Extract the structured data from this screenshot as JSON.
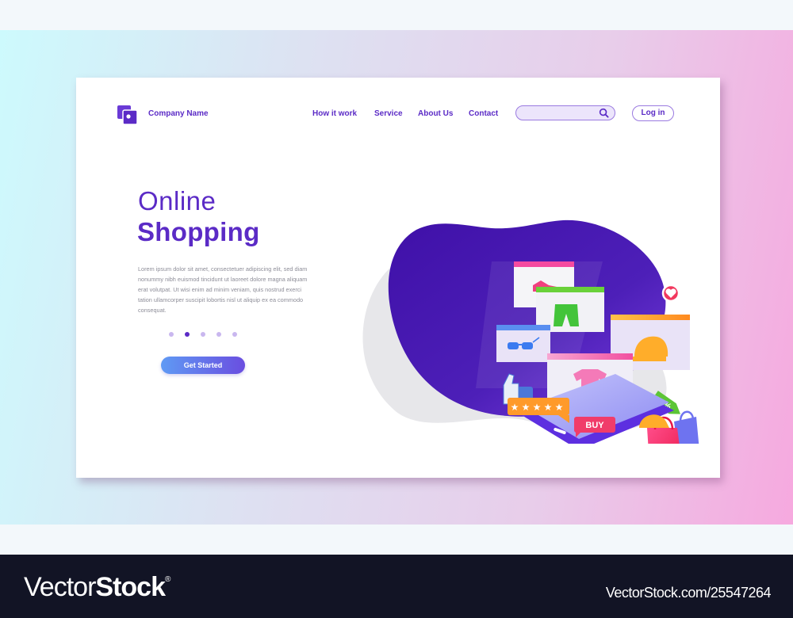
{
  "header": {
    "brand_name": "Company Name",
    "nav": [
      {
        "label": "How it work"
      },
      {
        "label": "Service"
      },
      {
        "label": "About Us"
      },
      {
        "label": "Contact"
      }
    ],
    "search": {
      "value": "",
      "placeholder": ""
    },
    "login_label": "Log in"
  },
  "hero": {
    "title_light": "Online",
    "title_bold": "Shopping",
    "description": "Lorem ipsum dolor sit amet, consectetuer adipiscing elit, sed diam nonummy nibh euismod tincidunt ut laoreet dolore magna aliquam erat volutpat. Ut wisi enim ad minim veniam, quis nostrud exerci tation ullamcorper suscipit lobortis nisl ut aliquip ex ea commodo consequat.",
    "carousel": {
      "total": 5,
      "active_index": 1
    },
    "cta_label": "Get Started"
  },
  "illustration": {
    "buy_label": "BUY",
    "rating_stars": 5,
    "discount_symbol": "%",
    "product_cards": [
      "shoe",
      "shorts",
      "sunglasses",
      "cap",
      "t-shirt"
    ]
  },
  "colors": {
    "brand": "#5b2bc6",
    "accent_light": "#ece5fb",
    "cta_start": "#5f9af4",
    "cta_end": "#6a4ee0",
    "blob": "#4a1db0",
    "buy": "#f03c6a",
    "rating": "#ff9a2a",
    "tag": "#5cc536"
  },
  "footer": {
    "logo_light": "Vector",
    "logo_bold": "Stock",
    "logo_mark": "®",
    "image_id": "VectorStock.com/25547264"
  }
}
